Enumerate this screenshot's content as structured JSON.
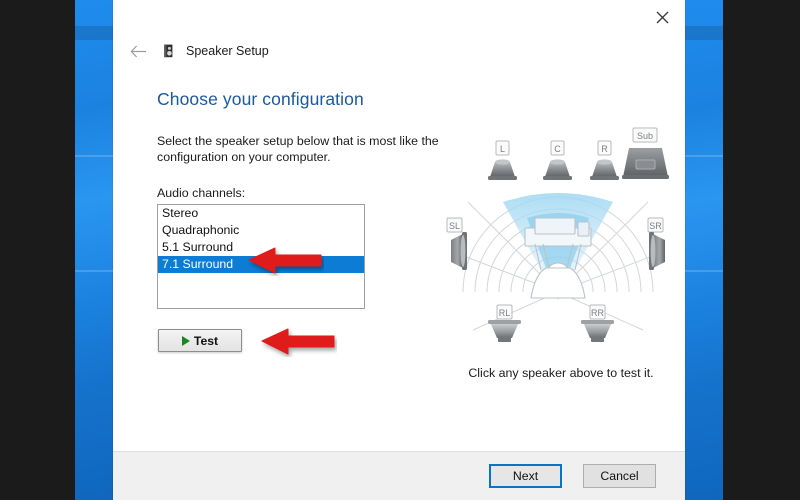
{
  "window": {
    "app_title": "Speaker Setup",
    "app_icon": "speaker-icon",
    "back_icon": "back-arrow-icon",
    "close_icon": "close-icon"
  },
  "page": {
    "title": "Choose your configuration",
    "instruction": "Select the speaker setup below that is most like the configuration on your computer.",
    "channels_label": "Audio channels:",
    "hint": "Click any speaker above to test it."
  },
  "audio_channels": {
    "options": [
      "Stereo",
      "Quadraphonic",
      "5.1 Surround",
      "7.1 Surround"
    ],
    "selected": "7.1 Surround",
    "selected_index": 3
  },
  "test": {
    "label": "Test",
    "icon": "play-icon"
  },
  "diagram": {
    "speakers": [
      {
        "id": "L",
        "label": "L",
        "type": "front"
      },
      {
        "id": "C",
        "label": "C",
        "type": "front"
      },
      {
        "id": "R",
        "label": "R",
        "type": "front"
      },
      {
        "id": "Sub",
        "label": "Sub",
        "type": "subwoofer"
      },
      {
        "id": "SL",
        "label": "SL",
        "type": "side-left"
      },
      {
        "id": "SR",
        "label": "SR",
        "type": "side-right"
      },
      {
        "id": "RL",
        "label": "RL",
        "type": "rear"
      },
      {
        "id": "RR",
        "label": "RR",
        "type": "rear"
      }
    ]
  },
  "command_bar": {
    "next_label": "Next",
    "cancel_label": "Cancel"
  },
  "annotations": {
    "arrow_list_icon": "red-arrow-left-icon",
    "arrow_test_icon": "red-arrow-left-icon"
  },
  "colors": {
    "accent_blue": "#19599f",
    "selection_blue": "#0c7cd5",
    "focus_blue": "#0b72c4",
    "annotation_red": "#e01b1b",
    "desktop_blue": "#1b82e0",
    "play_green": "#17871f"
  }
}
